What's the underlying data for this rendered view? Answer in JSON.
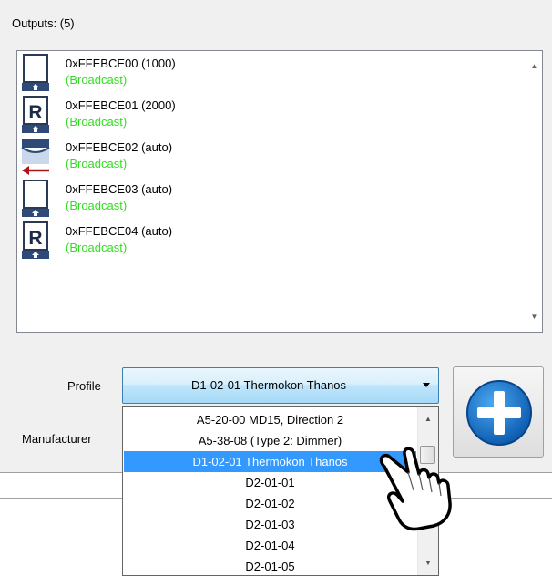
{
  "outputs": {
    "label": "Outputs: (5)",
    "items": [
      {
        "name": "0xFFEBCE00 (1000)",
        "sub": "(Broadcast)",
        "icon": "blank-device-icon"
      },
      {
        "name": "0xFFEBCE01 (2000)",
        "sub": "(Broadcast)",
        "icon": "r-device-icon"
      },
      {
        "name": "0xFFEBCE02 (auto)",
        "sub": "(Broadcast)",
        "icon": "shutter-arrow-icon"
      },
      {
        "name": "0xFFEBCE03 (auto)",
        "sub": "(Broadcast)",
        "icon": "blank-device-icon"
      },
      {
        "name": "0xFFEBCE04 (auto)",
        "sub": "(Broadcast)",
        "icon": "r-device-icon"
      }
    ]
  },
  "profile": {
    "label": "Profile",
    "selected": "D1-02-01 Thermokon Thanos"
  },
  "manufacturer": {
    "label": "Manufacturer"
  },
  "dropdown": {
    "options": [
      "A5-20-00 MD15, Direction 2",
      "A5-38-08 (Type 2: Dimmer)",
      "D1-02-01 Thermokon Thanos",
      "D2-01-01",
      "D2-01-02",
      "D2-01-03",
      "D2-01-04",
      "D2-01-05"
    ],
    "selected_index": 2
  },
  "colors": {
    "broadcast": "#33dd22",
    "selection": "#3399ff",
    "add_button": "#1a6fc4"
  },
  "icons": {
    "add": "plus-circle-icon",
    "cursor": "hand-pointer-icon"
  }
}
